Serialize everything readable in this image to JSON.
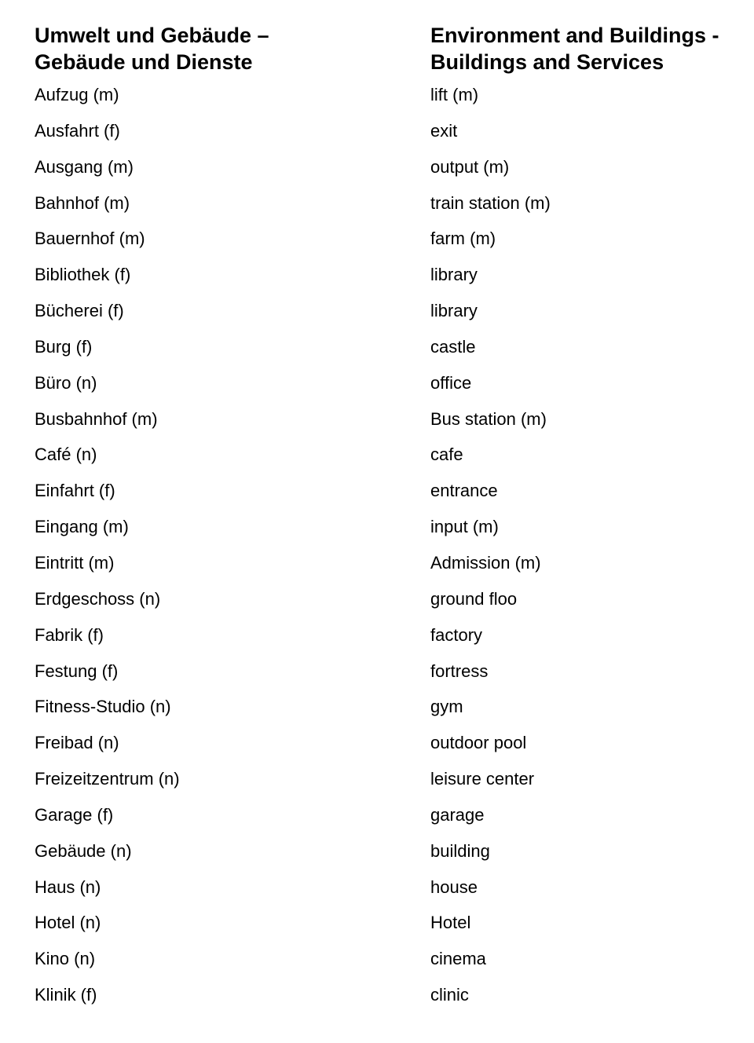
{
  "german": {
    "heading_line1": "Umwelt und Gebäude –",
    "heading_line2": "Gebäude und Dienste",
    "terms": [
      "Aufzug (m)",
      "Ausfahrt (f)",
      "Ausgang (m)",
      "Bahnhof (m)",
      "Bauernhof (m)",
      "Bibliothek (f)",
      "Bücherei (f)",
      "Burg (f)",
      "Büro (n)",
      "Busbahnhof (m)",
      "Café (n)",
      "Einfahrt (f)",
      "Eingang (m)",
      "Eintritt (m)",
      "Erdgeschoss (n)",
      "Fabrik (f)",
      "Festung (f)",
      "Fitness-Studio (n)",
      "Freibad (n)",
      "Freizeitzentrum (n)",
      "Garage (f)",
      "Gebäude (n)",
      "Haus (n)",
      "Hotel (n)",
      "Kino (n)",
      "Klinik (f)"
    ]
  },
  "english": {
    "heading_line1": "Environment and Buildings -",
    "heading_line2": "Buildings and Services",
    "terms": [
      "lift (m)",
      "exit",
      "output (m)",
      "train station (m)",
      "farm (m)",
      "library",
      "library",
      "castle",
      "office",
      "Bus station (m)",
      "cafe",
      "entrance",
      "input (m)",
      "Admission (m)",
      "ground floo",
      "factory",
      "fortress",
      "gym",
      "outdoor pool",
      "leisure center",
      "garage",
      "building",
      "house",
      "Hotel",
      "cinema",
      "clinic"
    ]
  }
}
